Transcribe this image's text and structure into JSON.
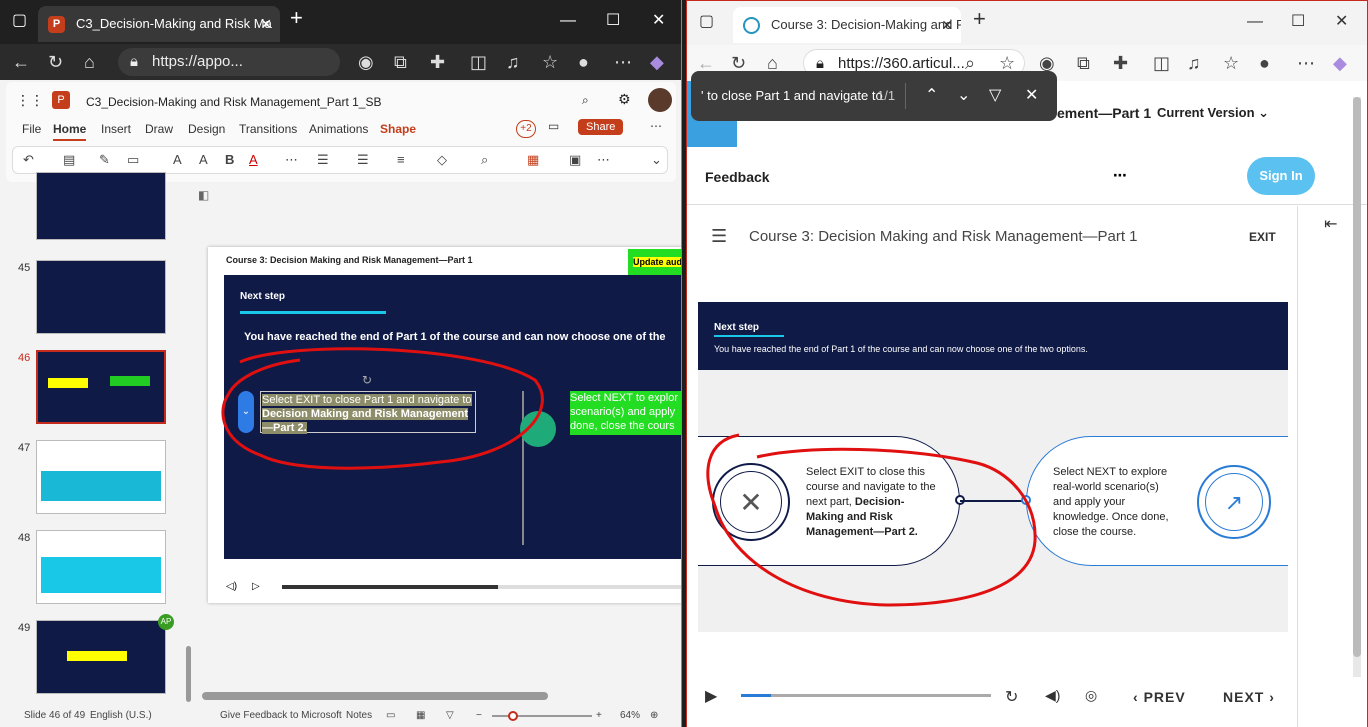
{
  "left_window": {
    "tab_title": "C3_Decision-Making and Risk Ma",
    "url": "https://appo...",
    "ppt": {
      "file_title": "C3_Decision-Making and Risk Management_Part 1_SB",
      "menu": [
        "File",
        "Home",
        "Insert",
        "Draw",
        "Design",
        "Transitions",
        "Animations",
        "Shape"
      ],
      "collab_count": "+2",
      "share_label": "Share",
      "thumbs": [
        {
          "num": ""
        },
        {
          "num": "45"
        },
        {
          "num": "46"
        },
        {
          "num": "47"
        },
        {
          "num": "48"
        },
        {
          "num": "49"
        }
      ],
      "thumb_badge": "AP",
      "slide": {
        "course_title": "Course 3: Decision Making and Risk Management—Part 1",
        "update_tag": "Update aud",
        "section": "Next step",
        "headline": "You have reached the end of Part 1 of the course and can now choose one of the",
        "exit_text": "Select EXIT to close Part 1 and navigate to",
        "exit_bold": "Decision Making and Risk Management—Part 2.",
        "next_text": "Select NEXT to explor scenario(s) and apply done, close the cours"
      },
      "status": {
        "slide_info": "Slide 46 of 49",
        "language": "English (U.S.)",
        "feedback": "Give Feedback to Microsoft",
        "notes": "Notes",
        "zoom": "64%"
      }
    }
  },
  "right_window": {
    "tab_title": "Course 3: Decision-Making and Ri",
    "url": "https://360.articul...",
    "find": {
      "query": "' to close Part 1 and navigate to",
      "count": "1/1"
    },
    "course_header_partial": "ement—Part 1",
    "version_label": "Current Version",
    "feedback_label": "Feedback",
    "sign_in": "Sign In",
    "player": {
      "title": "Course 3: Decision Making and Risk Management—Part 1",
      "exit": "EXIT",
      "section": "Next step",
      "subtitle": "You have reached the end of Part 1 of the course and can now choose one of the two options.",
      "exit_option": "Select EXIT to close this course and navigate to the next part,",
      "exit_option_bold": "Decision-Making and Risk Management—Part 2.",
      "next_option": "Select NEXT to explore real-world scenario(s) and apply your knowledge. Once done, close the course.",
      "prev_label": "PREV",
      "next_label": "NEXT",
      "progress": 0.12
    }
  }
}
